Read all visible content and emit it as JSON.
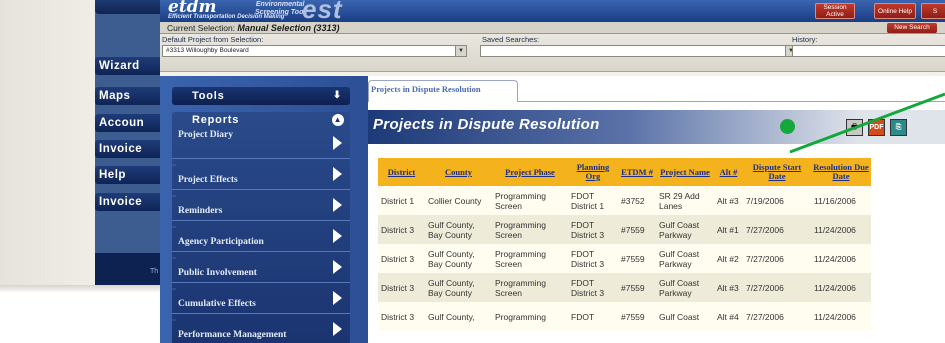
{
  "background_app": {
    "nav": [
      "Wizard",
      "Maps",
      "Accoun",
      "Invoice",
      "Help",
      "Invoice"
    ],
    "footer_text": "Th"
  },
  "header": {
    "logo": "etdm",
    "logo_sub": "Efficient Transportation Decision Making",
    "env_label_line1": "Environmental",
    "env_label_line2": "Screening Tool",
    "est_word": "est",
    "session_active": "Session\nActive",
    "online_help": "Online Help",
    "extra_btn": "S"
  },
  "current_selection": {
    "label": "Current Selection:",
    "value": "Manual Selection (3313)",
    "new_search": "New Search"
  },
  "selectors": {
    "default_project_label": "Default Project from Selection:",
    "default_project_value": "#3313 Willoughby Boulevard",
    "saved_searches_label": "Saved Searches:",
    "saved_searches_value": "",
    "history_label": "History:",
    "history_value": ""
  },
  "sidebar": {
    "tools": "Tools",
    "reports": "Reports",
    "items": [
      "Project Diary",
      "Project Effects",
      "Reminders",
      "Agency Participation",
      "Public Involvement",
      "Cumulative Effects",
      "Performance Management"
    ]
  },
  "content": {
    "tab": "Projects in Dispute Resolution",
    "title": "Projects in Dispute Resolution",
    "icons": [
      "printer-icon",
      "pdf-icon",
      "export-icon"
    ]
  },
  "table": {
    "headers": [
      "District",
      "County",
      "Project Phase",
      "Planning Org",
      "ETDM #",
      "Project Name",
      "Alt #",
      "Dispute Start Date",
      "Resolution Due Date"
    ],
    "rows": [
      [
        "District 1",
        "Collier County",
        "Programming Screen",
        "FDOT District 1",
        "#3752",
        "SR 29 Add Lanes",
        "Alt #3",
        "7/19/2006",
        "11/16/2006"
      ],
      [
        "District 3",
        "Gulf County, Bay County",
        "Programming Screen",
        "FDOT District 3",
        "#7559",
        "Gulf Coast Parkway",
        "Alt #1",
        "7/27/2006",
        "11/24/2006"
      ],
      [
        "District 3",
        "Gulf County, Bay County",
        "Programming Screen",
        "FDOT District 3",
        "#7559",
        "Gulf Coast Parkway",
        "Alt #2",
        "7/27/2006",
        "11/24/2006"
      ],
      [
        "District 3",
        "Gulf County, Bay County",
        "Programming Screen",
        "FDOT District 3",
        "#7559",
        "Gulf Coast Parkway",
        "Alt #3",
        "7/27/2006",
        "11/24/2006"
      ],
      [
        "District 3",
        "Gulf County,",
        "Programming",
        "FDOT",
        "#7559",
        "Gulf Coast",
        "Alt #4",
        "7/27/2006",
        "11/24/2006"
      ]
    ]
  },
  "colors": {
    "header_blue": "#1a3d84",
    "table_header": "#f4b31d",
    "annotation_green": "#12a83c",
    "button_red": "#c0392b"
  }
}
